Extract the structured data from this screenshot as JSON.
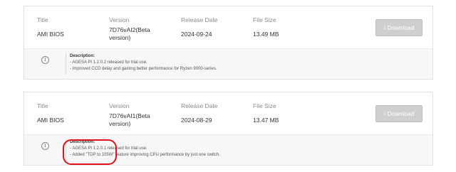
{
  "columns": {
    "title": "Title",
    "version": "Version",
    "release_date": "Release Date",
    "file_size": "File Size"
  },
  "downloads": [
    {
      "title": "AMI BIOS",
      "version": "7D76vAI2(Beta version)",
      "release_date": "2024-09-24",
      "file_size": "13.49 MB",
      "button_label": "Download",
      "description_title": "Description:",
      "description_lines": [
        "- AGESA PI 1.2.0.2 released for trial use.",
        "- Improved CCD delay and gaining better performance for Ryzen 9000-series."
      ]
    },
    {
      "title": "AMI BIOS",
      "version": "7D76vAI1(Beta version)",
      "release_date": "2024-08-29",
      "file_size": "13.47 MB",
      "button_label": "Download",
      "description_title": "Description:",
      "description_lines": [
        "- AGESA PI 1.2.0.1 released for trial use.",
        "- Added \"TDP to 105W\" feature improving CPU performance by just one switch."
      ]
    }
  ],
  "icons": {
    "info": "info-icon",
    "download": "download-icon"
  },
  "colors": {
    "button_bg": "#cfcfcf",
    "desc_bg": "#f7f7f7",
    "highlight": "#e0121a"
  }
}
